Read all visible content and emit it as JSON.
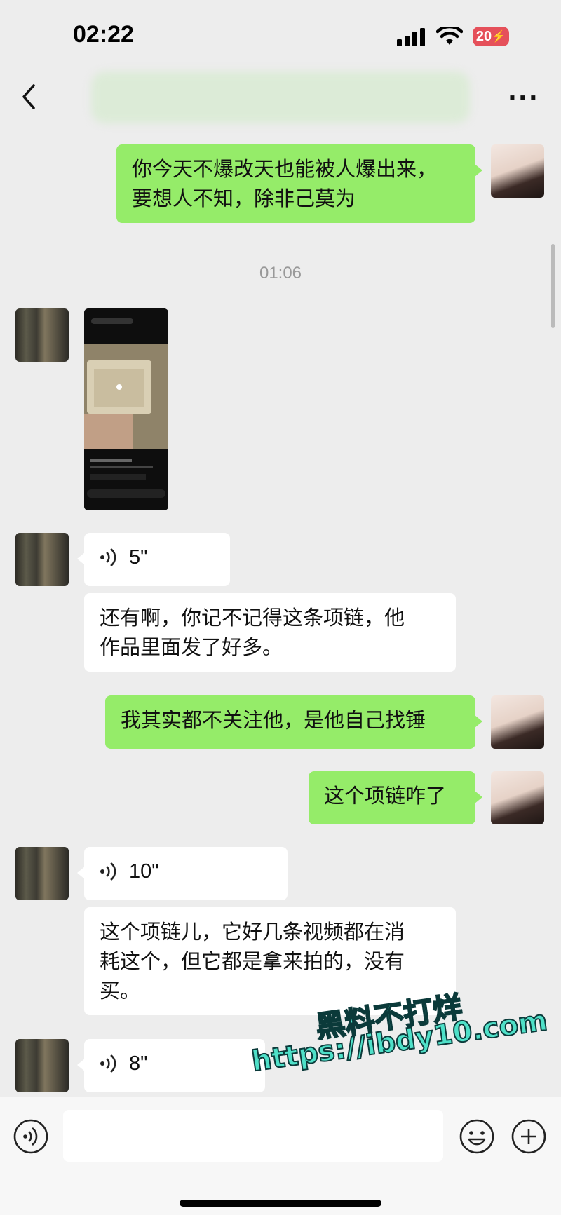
{
  "status": {
    "time": "02:22",
    "battery": "20"
  },
  "messages": {
    "m1_line1": "你今天不爆改天也能被人爆出来，",
    "m1_line2": "要想人不知，除非己莫为",
    "timestamp": "01:06",
    "voice1": "5\"",
    "m3_line1": "还有啊，你记不记得这条项链，他",
    "m3_line2": "作品里面发了好多。",
    "m4": "我其实都不关注他，是他自己找锤",
    "m5": "这个项链咋了",
    "voice2": "10\"",
    "m7_line1": "这个项链儿，它好几条视频都在消",
    "m7_line2": "耗这个，但它都是拿来拍的，没有",
    "m7_line3": "买。",
    "voice3": "8\""
  },
  "watermark": {
    "line1": "黑料不打烊",
    "line2": "https://ibdy10.com"
  },
  "icons": {
    "back": "chevron-left-icon",
    "more": "more-icon",
    "voice": "voice-icon",
    "emoji": "emoji-icon",
    "add": "plus-icon"
  },
  "colors": {
    "sent_bubble": "#95ec69",
    "received_bubble": "#ffffff",
    "background": "#ededed"
  }
}
